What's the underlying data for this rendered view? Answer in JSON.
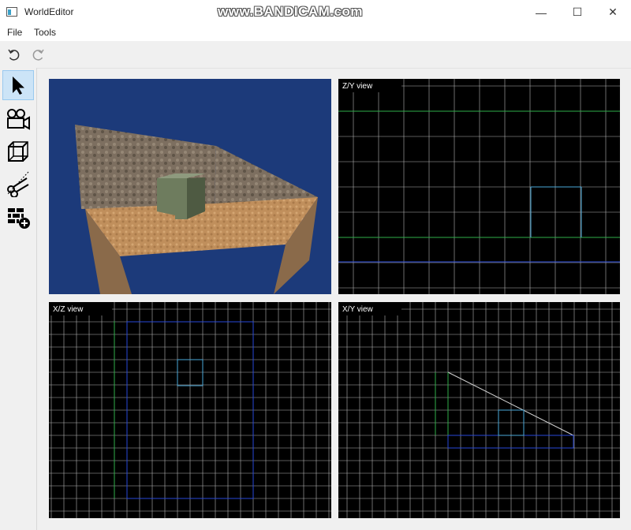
{
  "window": {
    "title": "WorldEditor",
    "watermark": "www.BANDICAM.com"
  },
  "window_controls": {
    "minimize": "—",
    "maximize": "☐",
    "close": "✕"
  },
  "menu": {
    "items": [
      "File",
      "Tools"
    ]
  },
  "toolbar": {
    "undo_icon": "undo-icon",
    "redo_icon": "redo-icon"
  },
  "sidebar": {
    "tools": [
      {
        "name": "select-tool",
        "icon": "cursor-arrow-icon",
        "active": true
      },
      {
        "name": "camera-tool",
        "icon": "camera-icon",
        "active": false
      },
      {
        "name": "box-tool",
        "icon": "cube-icon",
        "active": false
      },
      {
        "name": "clip-tool",
        "icon": "scissors-icon",
        "active": false
      },
      {
        "name": "add-brush-tool",
        "icon": "brick-add-icon",
        "active": false
      }
    ]
  },
  "viewports": {
    "perspective": {
      "label": "",
      "background": "#1c3a7a"
    },
    "zy": {
      "label": "Z/Y view"
    },
    "xz": {
      "label": "X/Z view"
    },
    "xy": {
      "label": "X/Y view"
    }
  },
  "colors": {
    "grid": "#b4b4b4",
    "axis_green": "#2fae4a",
    "axis_blue": "#2848d8",
    "selection_cyan": "#4aa8d8",
    "selected_tool_bg": "#cce4f7"
  }
}
